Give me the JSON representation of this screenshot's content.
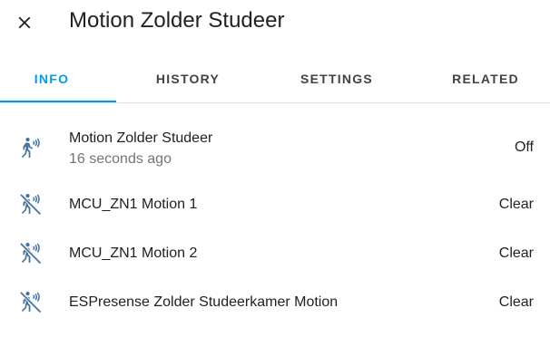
{
  "dialog": {
    "title": "Motion Zolder Studeer",
    "close_icon": "close-icon"
  },
  "tabs": [
    {
      "label": "INFO",
      "active": true
    },
    {
      "label": "HISTORY",
      "active": false
    },
    {
      "label": "SETTINGS",
      "active": false
    },
    {
      "label": "RELATED",
      "active": false
    }
  ],
  "rows": [
    {
      "name": "Motion Zolder Studeer",
      "secondary": "16 seconds ago",
      "state": "Off",
      "icon": "motion-sensor-icon"
    },
    {
      "name": "MCU_ZN1 Motion 1",
      "state": "Clear",
      "icon": "motion-sensor-off-icon"
    },
    {
      "name": "MCU_ZN1 Motion 2",
      "state": "Clear",
      "icon": "motion-sensor-off-icon"
    },
    {
      "name": "ESPresense Zolder Studeerkamer Motion",
      "state": "Clear",
      "icon": "motion-sensor-off-icon"
    }
  ],
  "colors": {
    "accent": "#039be5",
    "icon": "#44739e",
    "text": "#212121",
    "secondary_text": "#757575",
    "divider": "#e0e0e0"
  }
}
